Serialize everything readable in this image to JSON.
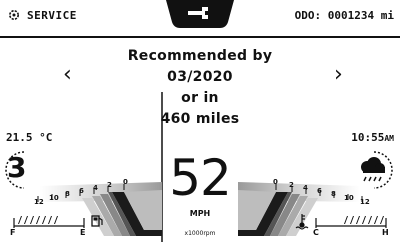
{
  "header": {
    "service_label": "SERVICE",
    "odometer_label": "ODO:",
    "odometer_value": "0001234",
    "odometer_unit": "mi"
  },
  "service_message": {
    "line1": "Recommended by",
    "line2": "03/2020",
    "line3": "or in",
    "line4": "460 miles"
  },
  "nav": {
    "prev": "‹",
    "next": "›"
  },
  "left": {
    "temperature": "21.5 °C",
    "gear": "3",
    "rpm_ticks": [
      "12",
      "10",
      "8",
      "6",
      "4",
      "2",
      "0"
    ],
    "fuel_e": "E",
    "fuel_f": "F",
    "fuel_level_pct": 55
  },
  "right": {
    "clock": "10:55",
    "clock_suffix": "AM",
    "weather_icon": "rain-cloud-icon",
    "rpm_ticks": [
      "0",
      "2",
      "4",
      "6",
      "8",
      "10",
      "12"
    ],
    "temp_c": "C",
    "temp_h": "H",
    "engine_temp_pct": 60
  },
  "center": {
    "speed": "52",
    "speed_unit": "MPH",
    "rpm_unit": "x1000rpm"
  },
  "colors": {
    "ink": "#111111",
    "gauge_dark": "#1b1b1b",
    "gauge_mid": "#7a7a7a",
    "gauge_light": "#c8c8c8"
  }
}
